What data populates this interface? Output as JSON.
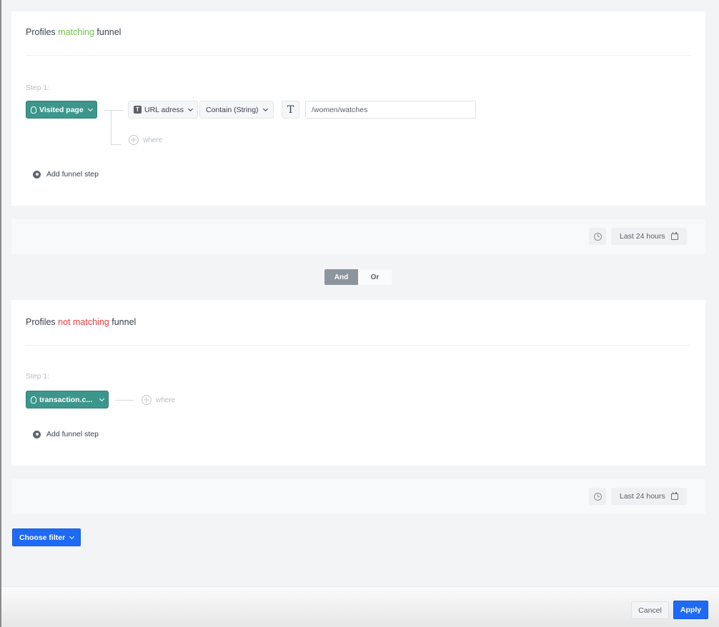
{
  "funnel_matching": {
    "title_prefix": "Profiles",
    "title_highlight": "matching",
    "title_suffix": "funnel",
    "step_label": "Step 1:",
    "event": "Visited page",
    "parameter": "URL adress",
    "operator": "Contain (String)",
    "value": "/women/watches",
    "where_label": "where",
    "add_step_label": "Add funnel step",
    "time_range": "Last 24 hours"
  },
  "logic_toggle": {
    "options": [
      "And",
      "Or"
    ],
    "selected": "And"
  },
  "funnel_not_matching": {
    "title_prefix": "Profiles",
    "title_highlight": "not matching",
    "title_suffix": "funnel",
    "step_label": "Step 1:",
    "event": "transaction.c...",
    "where_label": "where",
    "add_step_label": "Add funnel step",
    "time_range": "Last 24 hours"
  },
  "choose_filter_label": "Choose filter",
  "footer": {
    "cancel_label": "Cancel",
    "apply_label": "Apply"
  },
  "colors": {
    "matching": "#6fc04b",
    "not_matching": "#f0393e",
    "event_button": "#3d968c",
    "primary": "#1e6af5"
  }
}
